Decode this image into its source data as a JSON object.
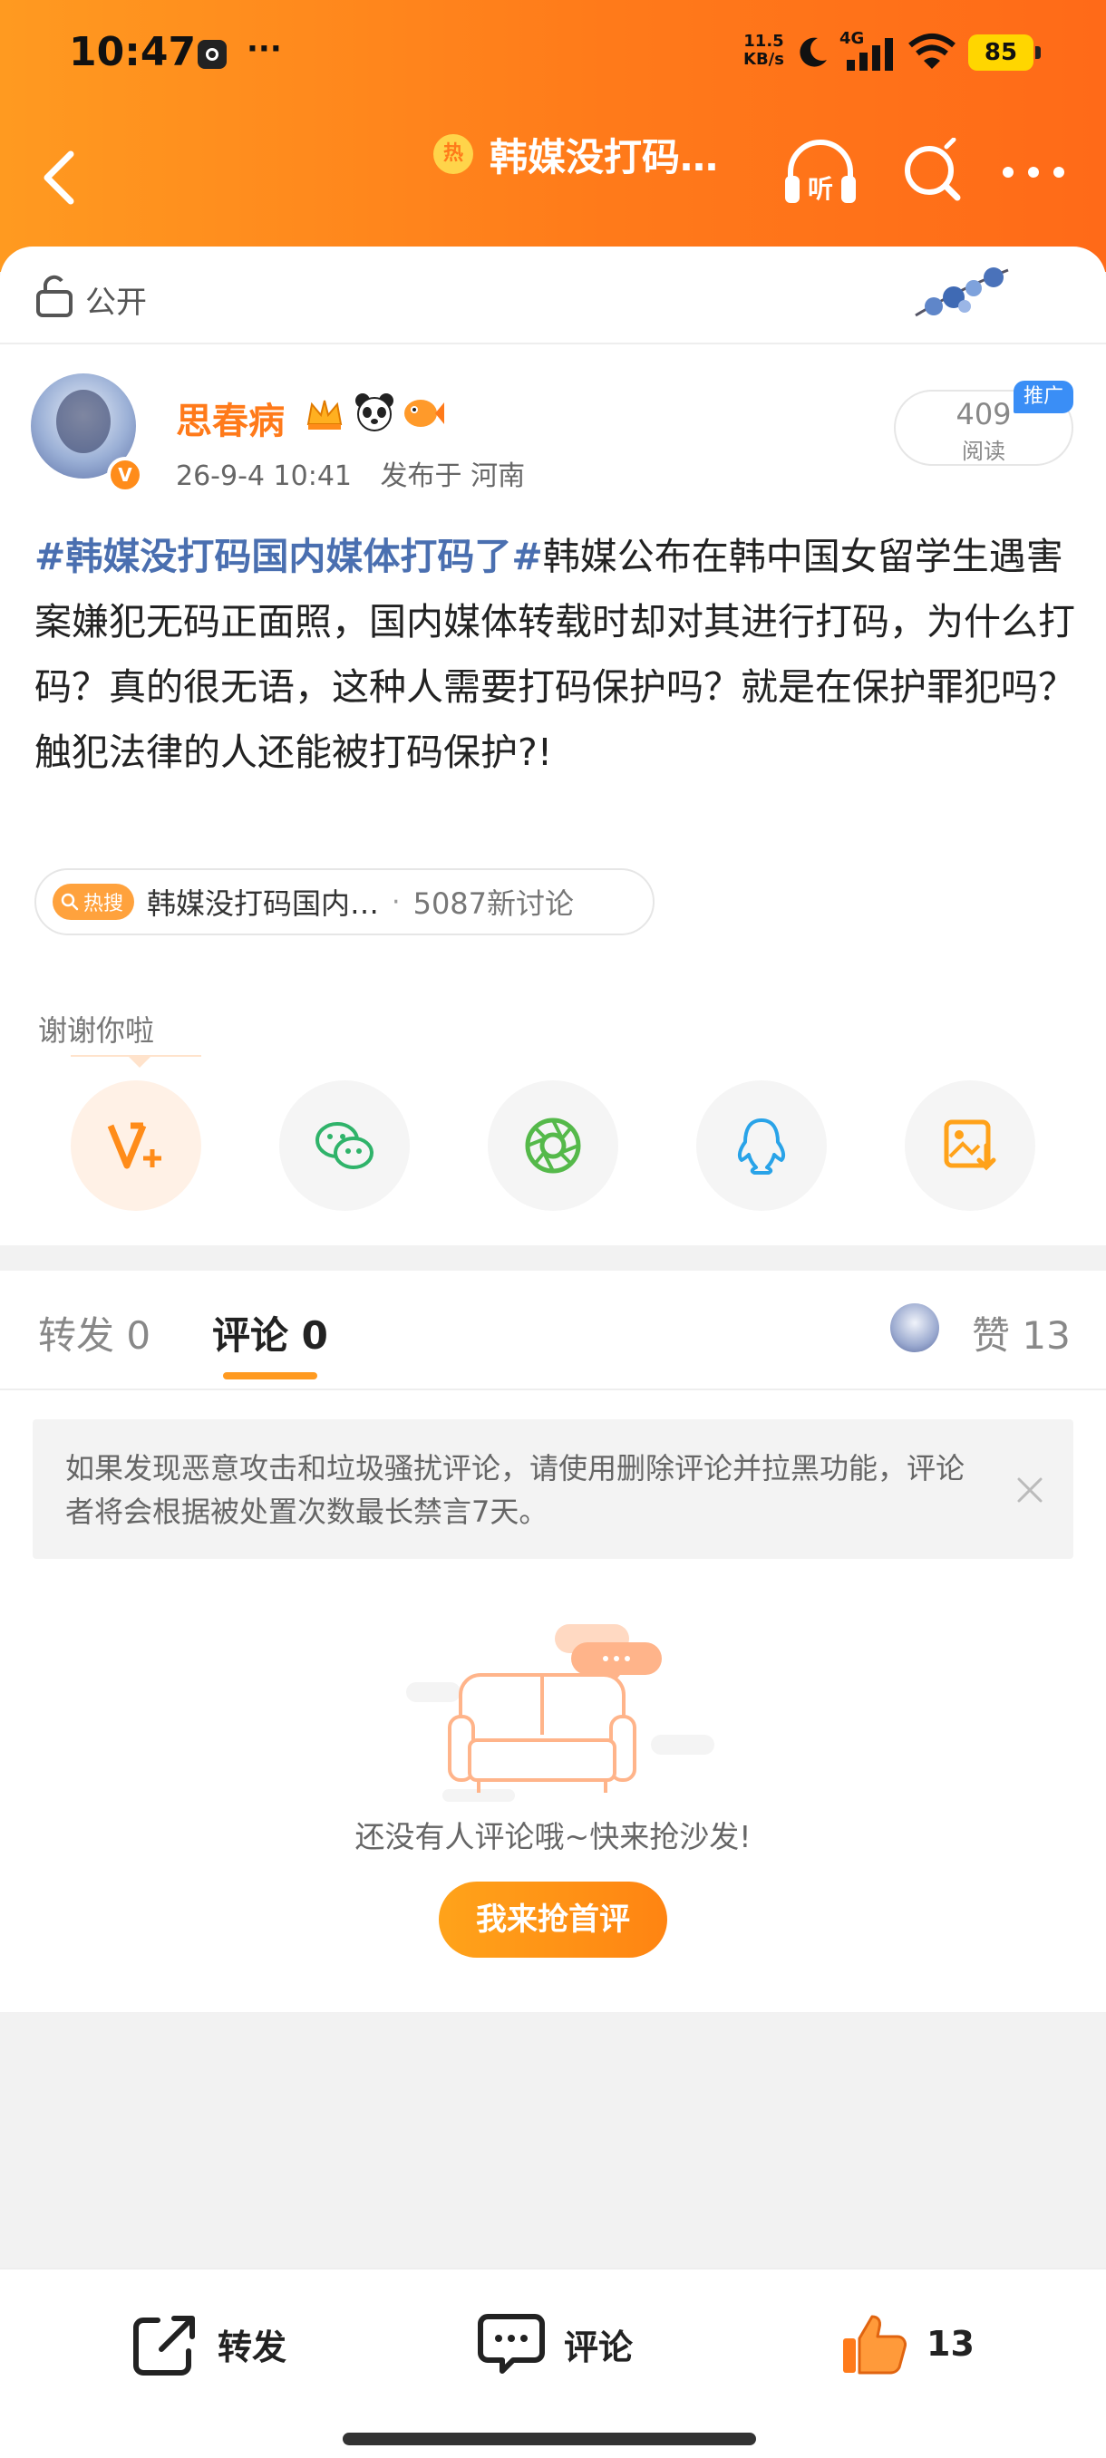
{
  "status_bar": {
    "time": "10:47",
    "dots": "···",
    "speed_value": "11.5",
    "speed_unit": "KB/s",
    "network": "4G",
    "battery": "85"
  },
  "nav": {
    "title": "韩媒没打码…",
    "hot_badge": "热",
    "listen_label": "听"
  },
  "visibility": {
    "label": "公开"
  },
  "post": {
    "username": "思春病",
    "verified_mark": "V",
    "timestamp": "26-9-4 10:41",
    "published_from": "发布于 河南",
    "read_count": "409",
    "read_label": "阅读",
    "promo_tag": "推广",
    "topic": "#韩媒没打码国内媒体打码了#",
    "body": "韩媒公布在韩中国女留学生遇害案嫌犯无码正面照，国内媒体转载时却对其进行打码，为什么打码？真的很无语，这种人需要打码保护吗？就是在保护罪犯吗？触犯法律的人还能被打码保护?!"
  },
  "hot_search": {
    "tag": "热搜",
    "topic": "韩媒没打码国内…",
    "separator": "·",
    "count": "5087新讨论"
  },
  "share": {
    "thanks_label": "谢谢你啦",
    "buttons": [
      "v-plus-icon",
      "wechat-icon",
      "moments-icon",
      "qq-icon",
      "save-image-icon"
    ]
  },
  "tabs": {
    "repost": "转发 0",
    "comment": "评论 0",
    "like": "赞 13"
  },
  "comments": {
    "notice": "如果发现恶意攻击和垃圾骚扰评论，请使用删除评论并拉黑功能，评论者将会根据被处置次数最长禁言7天。",
    "empty_text": "还没有人评论哦~快来抢沙发!",
    "first_button": "我来抢首评"
  },
  "bottom_bar": {
    "repost": "转发",
    "comment": "评论",
    "like_count": "13"
  },
  "colors": {
    "brand_orange": "#ff7a1a",
    "topic_blue": "#4a6fb0",
    "promo_blue": "#3a8ef6"
  }
}
